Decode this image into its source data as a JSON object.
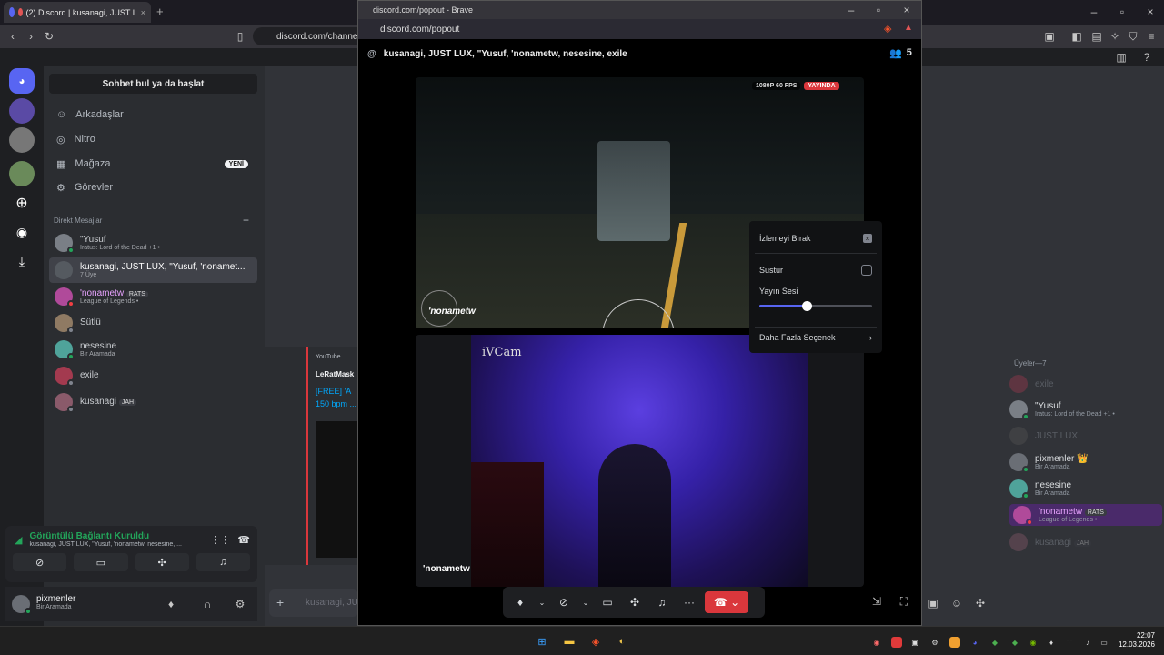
{
  "browser": {
    "tab_title": "(2) Discord | kusanagi, JUST L",
    "url": "discord.com/channel",
    "new_tab": "+"
  },
  "sidebar": {
    "search_label": "Sohbet bul ya da başlat",
    "nav": [
      {
        "label": "Arkadaşlar",
        "icon": "friends-icon"
      },
      {
        "label": "Nitro",
        "icon": "nitro-icon"
      },
      {
        "label": "Mağaza",
        "icon": "shop-icon",
        "badge": "YENİ"
      },
      {
        "label": "Görevler",
        "icon": "quests-icon"
      }
    ],
    "dm_header": "Direkt Mesajlar",
    "dm_add": "+",
    "dms": [
      {
        "name": "\"Yusuf",
        "status": "Iratus: Lord of the Dead +1 •",
        "color": "#7a7f86"
      },
      {
        "name": "kusanagi, JUST LUX, \"Yusuf, 'nonamet...",
        "status": "7 Üye",
        "color": "#555a60"
      },
      {
        "name": "'nonametw",
        "tag": "RATS",
        "status": "League of Legends •",
        "color": "#b04a9a"
      },
      {
        "name": "Sütlü",
        "status": "",
        "color": "#8f7a63"
      },
      {
        "name": "nesesine",
        "status": "Bir Aramada",
        "color": "#4fa39a"
      },
      {
        "name": "exile",
        "status": "",
        "color": "#a33a4f"
      },
      {
        "name": "kusanagi",
        "tag": "JAH",
        "status": "",
        "color": "#8a5a6a"
      }
    ]
  },
  "voice": {
    "title": "Görüntülü Bağlantı Kuruldu",
    "channel": "kusanagi, JUST LUX, \"Yusuf, 'nonametw, nesesine, ..."
  },
  "user": {
    "name": "pixmenler",
    "status": "Bir Aramada"
  },
  "chat": {
    "embed_source": "YouTube",
    "embed_title": "LeRatMask",
    "embed_link1": "[FREE] 'A",
    "embed_link2": "150 bpm ...",
    "input_placeholder": "kusanagi, JU"
  },
  "members": {
    "header": "Üyeler—7",
    "list": [
      {
        "name": "exile",
        "status": "",
        "dim": true
      },
      {
        "name": "\"Yusuf",
        "status": "Iratus: Lord of the Dead +1 •",
        "dim": false
      },
      {
        "name": "JUST LUX",
        "status": "",
        "dim": true
      },
      {
        "name": "pixmenler 👑",
        "status": "Bir Aramada",
        "dim": false
      },
      {
        "name": "nesesine",
        "status": "Bir Aramada",
        "dim": false
      },
      {
        "name": "'nonametw",
        "tag": "RATS",
        "status": "League of Legends •",
        "dim": false
      },
      {
        "name": "kusanagi",
        "tag": "JAH",
        "status": "",
        "dim": true
      }
    ]
  },
  "popout": {
    "window_title": "discord.com/popout - Brave",
    "address": "discord.com/popout",
    "header": "kusanagi, JUST LUX, \"Yusuf, 'nonametw, nesesine, exile",
    "participants": "5",
    "stream_quality": "1080P 60 FPS",
    "live_badge": "YAYINDA",
    "stream1_name": "'nonametw",
    "stream2_name": "'nonametw",
    "cam_label": "iVCam"
  },
  "context_menu": {
    "stop_watching": "İzlemeyi Bırak",
    "mute": "Sustur",
    "volume_label": "Yayın Sesi",
    "volume": 0.42,
    "more": "Daha Fazla Seçenek"
  },
  "taskbar": {
    "time": "22:07",
    "date": "12.03.2026"
  },
  "colors": {
    "accent": "#5865f2",
    "live": "#da373c",
    "hangup": "#da373c",
    "online": "#23a55a"
  }
}
